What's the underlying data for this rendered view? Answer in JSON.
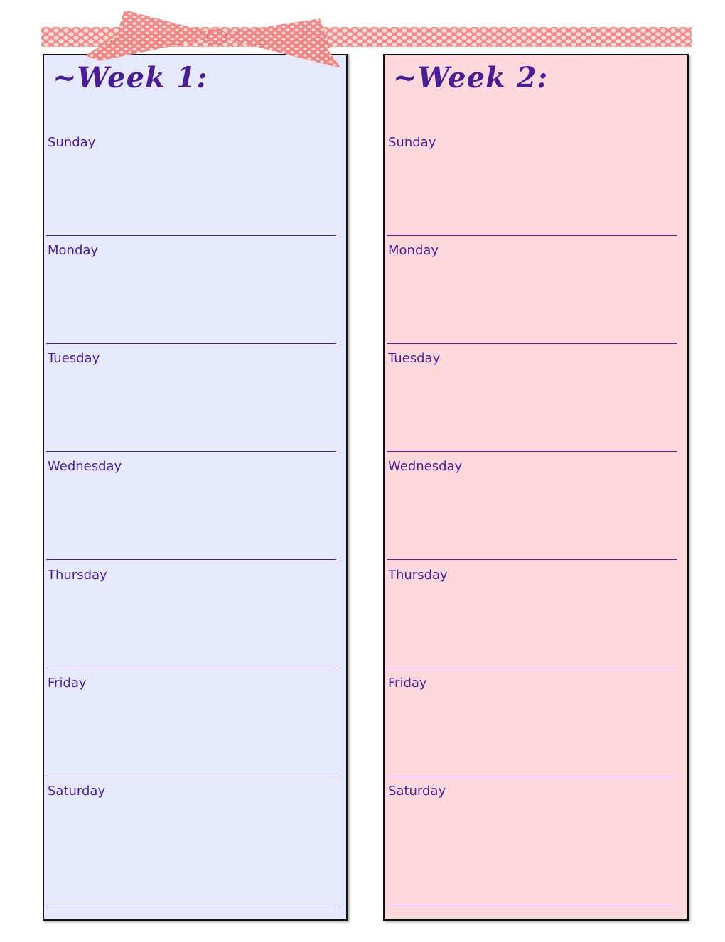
{
  "decoration": {
    "ribbon": "polka-dot-ribbon",
    "bow": "polka-dot-bow",
    "ribbon_color": "#f08a8a",
    "dot_color": "#fde0dc"
  },
  "weeks": [
    {
      "title": "~Week 1:",
      "background": "#e6e8fc",
      "days": [
        "Sunday",
        "Monday",
        "Tuesday",
        "Wednesday",
        "Thursday",
        "Friday",
        "Saturday"
      ]
    },
    {
      "title": "~Week 2:",
      "background": "#fdd9de",
      "days": [
        "Sunday",
        "Monday",
        "Tuesday",
        "Wednesday",
        "Thursday",
        "Friday",
        "Saturday"
      ]
    }
  ],
  "text_color": "#4a1f93"
}
